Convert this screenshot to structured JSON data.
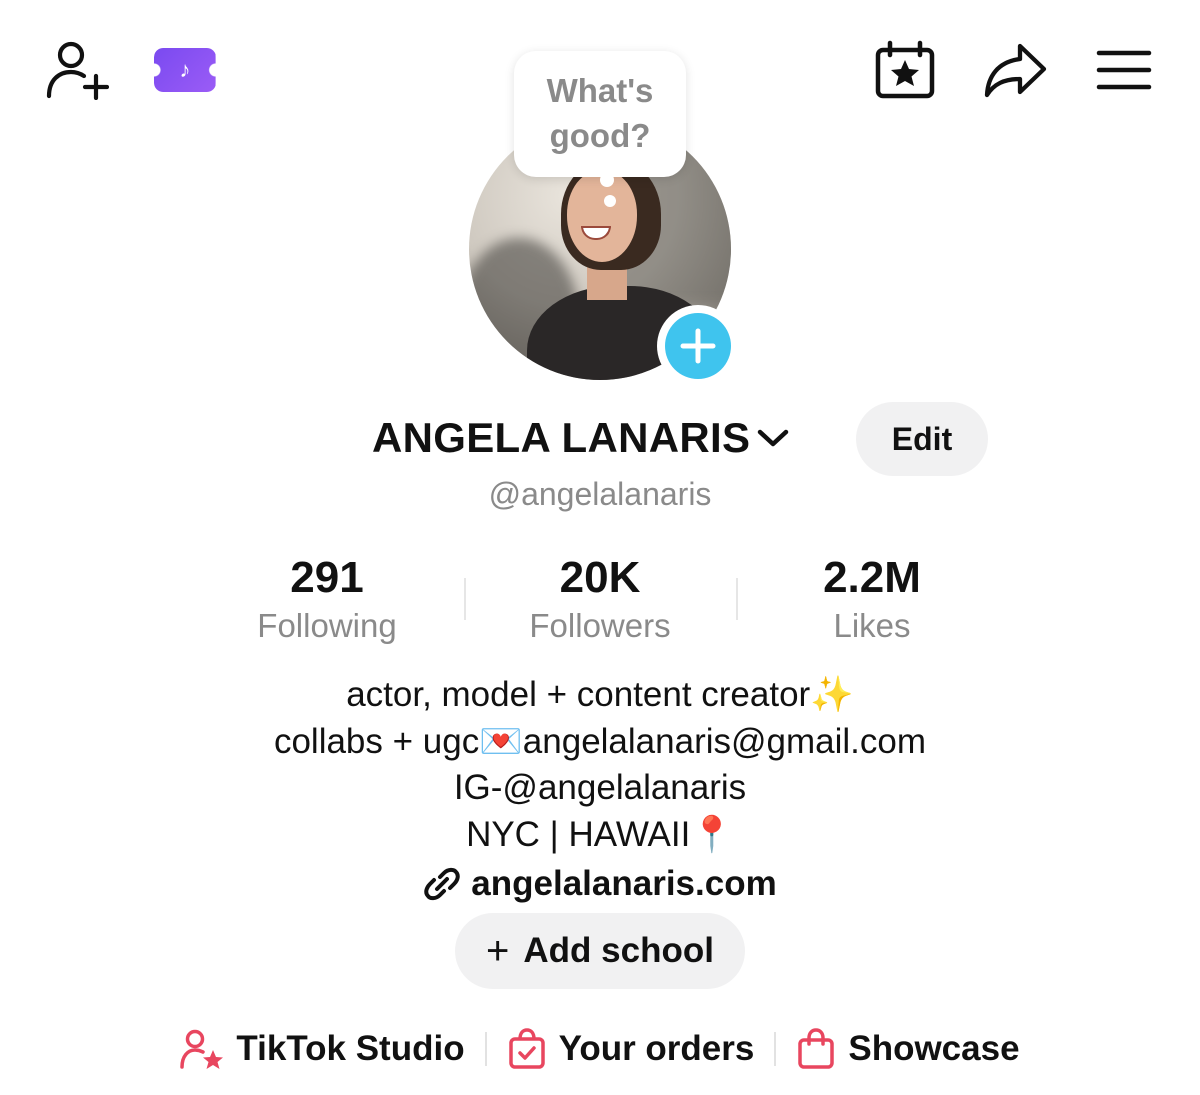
{
  "topbar": {
    "icons": [
      "add-friend-icon",
      "live-ticket-icon",
      "calendar-star-icon",
      "share-icon",
      "menu-icon"
    ],
    "ticket_glyph": "♪"
  },
  "story_bubble": {
    "text": "What's good?"
  },
  "profile": {
    "display_name": "ANGELA LANARIS",
    "username": "@angelalanaris",
    "edit_label": "Edit"
  },
  "stats": {
    "following": {
      "value": "291",
      "label": "Following"
    },
    "followers": {
      "value": "20K",
      "label": "Followers"
    },
    "likes": {
      "value": "2.2M",
      "label": "Likes"
    }
  },
  "bio": {
    "lines": [
      "actor, model + content creator✨",
      "collabs + ugc💌angelalanaris@gmail.com",
      "IG-@angelalanaris",
      "NYC | HAWAII📍"
    ],
    "website": "angelalanaris.com"
  },
  "add_school": {
    "plus": "+",
    "label": "Add school"
  },
  "bottom_links": {
    "studio": "TikTok Studio",
    "orders": "Your orders",
    "showcase": "Showcase"
  },
  "colors": {
    "accent_blue": "#3fc4ee",
    "ticket_purple": "#8a52f3",
    "pink_icon": "#e8465f",
    "muted_text": "#8a8a8a",
    "pill_bg": "#f1f1f2"
  }
}
